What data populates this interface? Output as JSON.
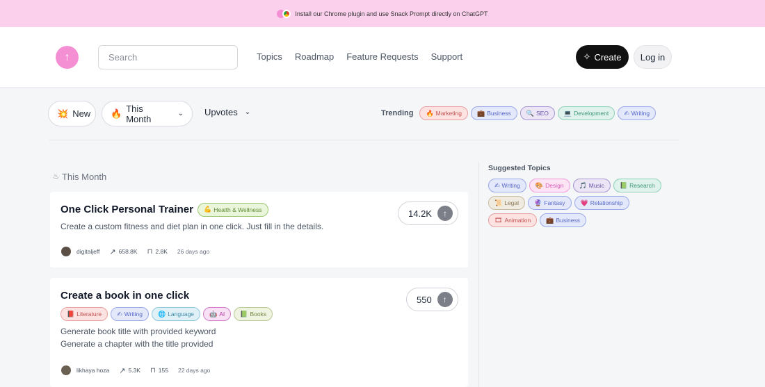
{
  "banner": {
    "text": "Install our Chrome plugin and use Snack Prompt directly on ChatGPT"
  },
  "header": {
    "search_placeholder": "Search",
    "nav": [
      "Topics",
      "Roadmap",
      "Feature Requests",
      "Support"
    ],
    "create_label": "Create",
    "login_label": "Log in"
  },
  "filters": {
    "new_label": "New",
    "period_label": "This Month",
    "sort_label": "Upvotes",
    "trending_label": "Trending",
    "trending": [
      {
        "icon": "🔥",
        "label": "Marketing",
        "color": "c-red"
      },
      {
        "icon": "💼",
        "label": "Business",
        "color": "c-blue"
      },
      {
        "icon": "🔍",
        "label": "SEO",
        "color": "c-purple"
      },
      {
        "icon": "💻",
        "label": "Development",
        "color": "c-green"
      },
      {
        "icon": "✍",
        "label": "Writing",
        "color": "c-blue"
      }
    ]
  },
  "section_title": "This Month",
  "cards": [
    {
      "title": "One Click Personal Trainer",
      "tags": [
        {
          "icon": "💪",
          "label": "Health & Wellness",
          "color": "c-lime"
        }
      ],
      "description": "Create a custom fitness and diet plan in one click. Just fill in the details.",
      "votes": "14.2K",
      "author": "digitaljeff",
      "views": "658.8K",
      "saves": "2.8K",
      "age": "26 days ago"
    },
    {
      "title": "Create a book in one click",
      "tags": [
        {
          "icon": "📕",
          "label": "Literature",
          "color": "c-red"
        },
        {
          "icon": "✍",
          "label": "Writing",
          "color": "c-blue"
        },
        {
          "icon": "🌐",
          "label": "Language",
          "color": "c-teal"
        },
        {
          "icon": "🤖",
          "label": "AI",
          "color": "c-magenta"
        },
        {
          "icon": "📗",
          "label": "Books",
          "color": "c-olive"
        }
      ],
      "description_lines": [
        "Generate book title with provided keyword",
        "Generate a chapter with the title provided"
      ],
      "votes": "550",
      "author": "likhaya hoza",
      "views": "5.3K",
      "saves": "155",
      "age": "22 days ago"
    }
  ],
  "suggested": {
    "title": "Suggested Topics",
    "topics": [
      {
        "icon": "✍",
        "label": "Writing",
        "color": "c-blue"
      },
      {
        "icon": "🎨",
        "label": "Design",
        "color": "c-pink"
      },
      {
        "icon": "🎵",
        "label": "Music",
        "color": "c-purple"
      },
      {
        "icon": "📗",
        "label": "Research",
        "color": "c-green"
      },
      {
        "icon": "📜",
        "label": "Legal",
        "color": "c-tan"
      },
      {
        "icon": "🔮",
        "label": "Fantasy",
        "color": "c-blue"
      },
      {
        "icon": "💗",
        "label": "Relationship",
        "color": "c-blue"
      },
      {
        "icon": "🎞",
        "label": "Animation",
        "color": "c-red"
      },
      {
        "icon": "💼",
        "label": "Business",
        "color": "c-blue"
      }
    ]
  }
}
